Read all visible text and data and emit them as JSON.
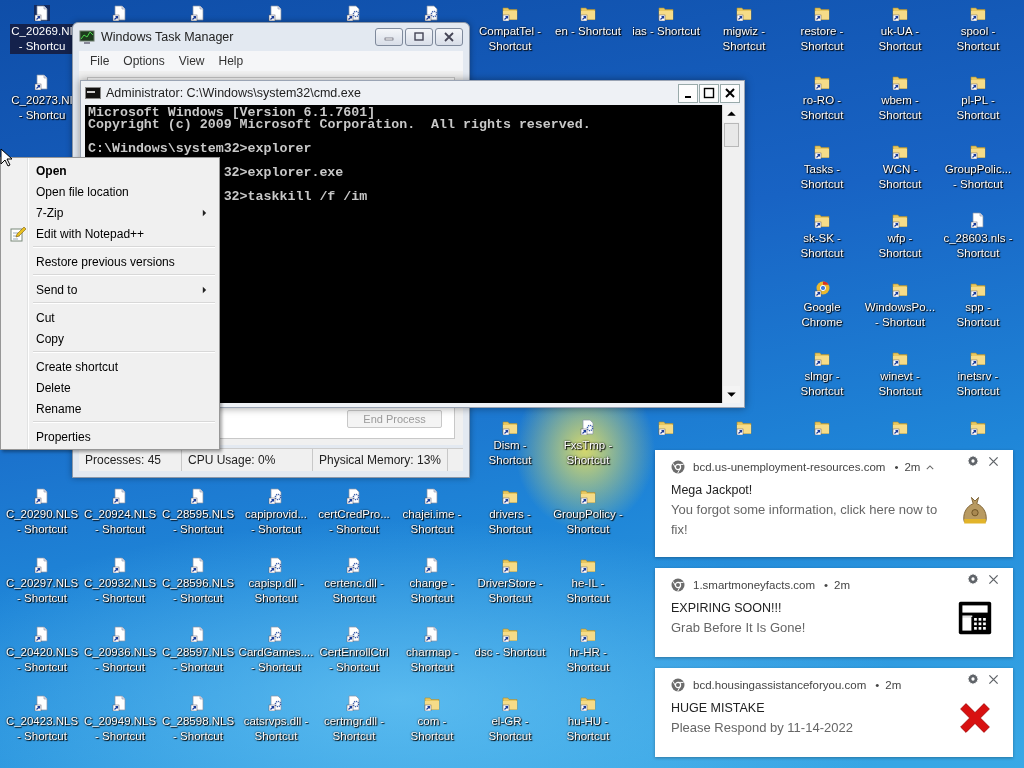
{
  "desktop": {
    "icon_rows": [
      [
        {
          "kind": "file",
          "label": "C_20269.NI\n- Shortcu",
          "selected": true
        },
        {
          "kind": "file",
          "selected": false
        },
        {
          "kind": "file",
          "selected": false
        },
        {
          "kind": "file",
          "selected": false
        },
        {
          "kind": "dll",
          "selected": false
        },
        {
          "kind": "dll",
          "selected": false
        },
        {
          "kind": "folder",
          "label": "CompatTel -\nShortcut",
          "selected": false
        },
        {
          "kind": "folder",
          "label": "en - Shortcut",
          "selected": false
        },
        {
          "kind": "folder",
          "label": "ias - Shortcut",
          "selected": false
        },
        {
          "kind": "folder",
          "label": "migwiz -\nShortcut",
          "selected": false
        },
        {
          "kind": "folder",
          "label": "restore -\nShortcut",
          "selected": false
        },
        {
          "kind": "folder",
          "label": "uk-UA -\nShortcut",
          "selected": false
        },
        {
          "kind": "folder",
          "label": "spool -\nShortcut",
          "selected": false
        }
      ],
      [
        {
          "kind": "file",
          "label": "C_20273.NI\n- Shortcu",
          "selected": false
        },
        null,
        null,
        null,
        null,
        null,
        null,
        null,
        null,
        null,
        {
          "kind": "folder",
          "label": "ro-RO -\nShortcut",
          "selected": false
        },
        {
          "kind": "folder",
          "label": "wbem -\nShortcut",
          "selected": false
        },
        {
          "kind": "folder",
          "label": "pl-PL -\nShortcut",
          "selected": false
        }
      ],
      [
        null,
        null,
        null,
        null,
        null,
        null,
        null,
        null,
        null,
        null,
        {
          "kind": "folder",
          "label": "Tasks -\nShortcut",
          "selected": false
        },
        {
          "kind": "folder",
          "label": "WCN -\nShortcut",
          "selected": false
        },
        {
          "kind": "folder",
          "label": "GroupPolic...\n- Shortcut",
          "selected": false
        }
      ],
      [
        null,
        null,
        null,
        null,
        null,
        null,
        null,
        null,
        null,
        null,
        {
          "kind": "folder",
          "label": "sk-SK -\nShortcut",
          "selected": false
        },
        {
          "kind": "folder",
          "label": "wfp -\nShortcut",
          "selected": false
        },
        {
          "kind": "file",
          "label": "c_28603.nls -\nShortcut",
          "selected": false
        }
      ],
      [
        null,
        null,
        null,
        null,
        null,
        null,
        null,
        null,
        null,
        null,
        {
          "kind": "chrome",
          "label": "Google\nChrome",
          "selected": false
        },
        {
          "kind": "folder",
          "label": "WindowsPo...\n- Shortcut",
          "selected": false
        },
        {
          "kind": "folder",
          "label": "spp -\nShortcut",
          "selected": false
        }
      ],
      [
        null,
        null,
        null,
        null,
        null,
        null,
        null,
        null,
        null,
        null,
        {
          "kind": "folder",
          "label": "slmgr -\nShortcut",
          "selected": false
        },
        {
          "kind": "folder",
          "label": "winevt -\nShortcut",
          "selected": false
        },
        {
          "kind": "folder",
          "label": "inetsrv -\nShortcut",
          "selected": false
        }
      ],
      [
        null,
        null,
        null,
        null,
        null,
        null,
        {
          "kind": "folder",
          "label": "Dism -\nShortcut",
          "selected": false
        },
        {
          "kind": "dll",
          "label": "FxsTmp -\nShortcut",
          "selected": false
        },
        {
          "kind": "folder",
          "selected": false
        },
        {
          "kind": "folder",
          "selected": false
        },
        {
          "kind": "folder",
          "selected": false
        },
        {
          "kind": "folder",
          "selected": false
        },
        {
          "kind": "folder",
          "selected": false
        }
      ],
      [
        {
          "kind": "file",
          "label": "C_20290.NLS\n- Shortcut",
          "selected": false
        },
        {
          "kind": "file",
          "label": "C_20924.NLS\n- Shortcut",
          "selected": false
        },
        {
          "kind": "file",
          "label": "C_28595.NLS\n- Shortcut",
          "selected": false
        },
        {
          "kind": "dll",
          "label": "capiprovid...\n- Shortcut",
          "selected": false
        },
        {
          "kind": "dll",
          "label": "certCredPro...\n- Shortcut",
          "selected": false
        },
        {
          "kind": "file",
          "label": "chajei.ime -\nShortcut",
          "selected": false
        },
        {
          "kind": "folder",
          "label": "drivers -\nShortcut",
          "selected": false
        },
        {
          "kind": "folder",
          "label": "GroupPolicy -\nShortcut",
          "selected": false
        },
        null,
        null,
        null,
        null,
        null
      ],
      [
        {
          "kind": "file",
          "label": "C_20297.NLS\n- Shortcut",
          "selected": false
        },
        {
          "kind": "file",
          "label": "C_20932.NLS\n- Shortcut",
          "selected": false
        },
        {
          "kind": "file",
          "label": "C_28596.NLS\n- Shortcut",
          "selected": false
        },
        {
          "kind": "dll",
          "label": "capisp.dll -\nShortcut",
          "selected": false
        },
        {
          "kind": "dll",
          "label": "certenc.dll -\nShortcut",
          "selected": false
        },
        {
          "kind": "file",
          "label": "change -\nShortcut",
          "selected": false
        },
        {
          "kind": "folder",
          "label": "DriverStore -\nShortcut",
          "selected": false
        },
        {
          "kind": "folder",
          "label": "he-IL -\nShortcut",
          "selected": false
        },
        null,
        null,
        null,
        null,
        null
      ],
      [
        {
          "kind": "file",
          "label": "C_20420.NLS\n- Shortcut",
          "selected": false
        },
        {
          "kind": "file",
          "label": "C_20936.NLS\n- Shortcut",
          "selected": false
        },
        {
          "kind": "file",
          "label": "C_28597.NLS\n- Shortcut",
          "selected": false
        },
        {
          "kind": "dll",
          "label": "CardGames....\n- Shortcut",
          "selected": false
        },
        {
          "kind": "dll",
          "label": "CertEnrollCtrl\n- Shortcut",
          "selected": false
        },
        {
          "kind": "file",
          "label": "charmap -\nShortcut",
          "selected": false
        },
        {
          "kind": "folder",
          "label": "dsc - Shortcut",
          "selected": false
        },
        {
          "kind": "folder",
          "label": "hr-HR -\nShortcut",
          "selected": false
        },
        null,
        null,
        null,
        null,
        null
      ],
      [
        {
          "kind": "file",
          "label": "C_20423.NLS\n- Shortcut",
          "selected": false
        },
        {
          "kind": "file",
          "label": "C_20949.NLS\n- Shortcut",
          "selected": false
        },
        {
          "kind": "file",
          "label": "C_28598.NLS\n- Shortcut",
          "selected": false
        },
        {
          "kind": "dll",
          "label": "catsrvps.dll -\nShortcut",
          "selected": false
        },
        {
          "kind": "dll",
          "label": "certmgr.dll -\nShortcut",
          "selected": false
        },
        {
          "kind": "folder",
          "label": "com -\nShortcut",
          "selected": false
        },
        {
          "kind": "folder",
          "label": "el-GR -\nShortcut",
          "selected": false
        },
        {
          "kind": "folder",
          "label": "hu-HU -\nShortcut",
          "selected": false
        },
        null,
        null,
        null,
        null,
        null
      ]
    ]
  },
  "task_manager": {
    "title": "Windows Task Manager",
    "menu": [
      "File",
      "Options",
      "View",
      "Help"
    ],
    "end_process_button": {
      "label": "End Process",
      "disabled": true
    },
    "status_bar": [
      "Processes: 45",
      "CPU Usage: 0%",
      "Physical Memory: 13%"
    ]
  },
  "console": {
    "title": "Administrator: C:\\Windows\\system32\\cmd.exe",
    "lines": [
      {
        "kind": "output",
        "text": "Microsoft Windows [Version 6.1.7601]"
      },
      {
        "kind": "output",
        "text": "Copyright (c) 2009 Microsoft Corporation.  All rights reserved."
      },
      {
        "kind": "command",
        "text": "C:\\Windows\\system32>explorer"
      },
      {
        "kind": "command_covered",
        "text": "32>explorer.exe"
      },
      {
        "kind": "command_covered",
        "text": "32>taskkill /f /im"
      }
    ]
  },
  "context_menu": {
    "items": [
      {
        "kind": "item",
        "label": "Open",
        "default": true,
        "submenu": false,
        "has_icon": false
      },
      {
        "kind": "item",
        "label": "Open file location",
        "default": false,
        "submenu": false,
        "has_icon": false
      },
      {
        "kind": "item",
        "label": "7-Zip",
        "default": false,
        "submenu": true,
        "has_icon": false
      },
      {
        "kind": "item",
        "label": "Edit with Notepad++",
        "default": false,
        "submenu": false,
        "has_icon": true
      },
      {
        "kind": "separator"
      },
      {
        "kind": "item",
        "label": "Restore previous versions",
        "default": false,
        "submenu": false,
        "has_icon": false
      },
      {
        "kind": "separator"
      },
      {
        "kind": "item",
        "label": "Send to",
        "default": false,
        "submenu": true,
        "has_icon": false
      },
      {
        "kind": "separator"
      },
      {
        "kind": "item",
        "label": "Cut",
        "default": false,
        "submenu": false,
        "has_icon": false
      },
      {
        "kind": "item",
        "label": "Copy",
        "default": false,
        "submenu": false,
        "has_icon": false
      },
      {
        "kind": "separator"
      },
      {
        "kind": "item",
        "label": "Create shortcut",
        "default": false,
        "submenu": false,
        "has_icon": false
      },
      {
        "kind": "item",
        "label": "Delete",
        "default": false,
        "submenu": false,
        "has_icon": false
      },
      {
        "kind": "item",
        "label": "Rename",
        "default": false,
        "submenu": false,
        "has_icon": false
      },
      {
        "kind": "separator"
      },
      {
        "kind": "item",
        "label": "Properties",
        "default": false,
        "submenu": false,
        "has_icon": false
      }
    ]
  },
  "notifications": [
    {
      "site": "bcd.us-unemployment-resources.com",
      "dot": "•",
      "time": "2m",
      "expand_toggle": true,
      "title": "Mega Jackpot!",
      "body": "You forgot some information, click here now to fix!",
      "kind": "money-bag"
    },
    {
      "site": "1.smartmoneyfacts.com",
      "dot": "•",
      "time": "2m",
      "expand_toggle": false,
      "title": "EXPIRING SOON!!!",
      "body": "Grab Before It Is Gone!",
      "kind": "atm"
    },
    {
      "site": "bcd.housingassistanceforyou.com",
      "dot": "•",
      "time": "2m",
      "expand_toggle": false,
      "title": "HUGE MISTAKE",
      "body": "Please Respond by 11-14-2022",
      "kind": "cross"
    }
  ]
}
